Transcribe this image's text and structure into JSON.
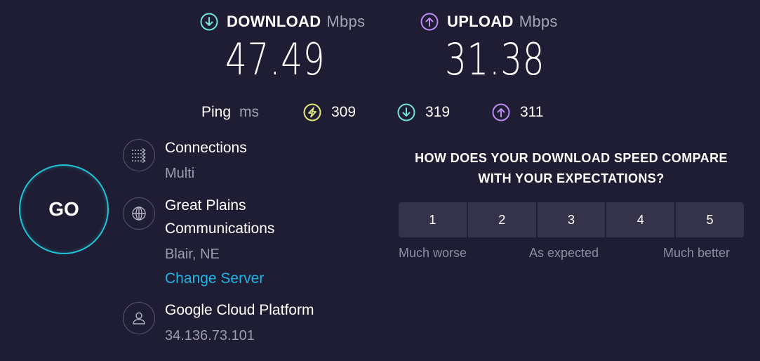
{
  "download": {
    "label": "DOWNLOAD",
    "unit": "Mbps",
    "value": "47.49"
  },
  "upload": {
    "label": "UPLOAD",
    "unit": "Mbps",
    "value": "31.38"
  },
  "ping": {
    "label": "Ping",
    "unit": "ms",
    "idle": "309",
    "down": "319",
    "up": "311"
  },
  "go": {
    "label": "GO"
  },
  "connections": {
    "title": "Connections",
    "value": "Multi"
  },
  "server": {
    "title_line1": "Great Plains",
    "title_line2": "Communications",
    "location": "Blair, NE",
    "change_label": "Change Server"
  },
  "host": {
    "title": "Google Cloud Platform",
    "ip": "34.136.73.101"
  },
  "survey": {
    "question_line1": "HOW DOES YOUR DOWNLOAD SPEED COMPARE",
    "question_line2": "WITH YOUR EXPECTATIONS?",
    "options": [
      "1",
      "2",
      "3",
      "4",
      "5"
    ],
    "low_label": "Much worse",
    "mid_label": "As expected",
    "high_label": "Much better"
  },
  "colors": {
    "background": "#1f1d33",
    "download_accent": "#6fe3d8",
    "upload_accent": "#b98cf2",
    "ping_accent": "#e6e57a",
    "go_ring": "#1fc4d8",
    "link": "#1eb5e6"
  }
}
